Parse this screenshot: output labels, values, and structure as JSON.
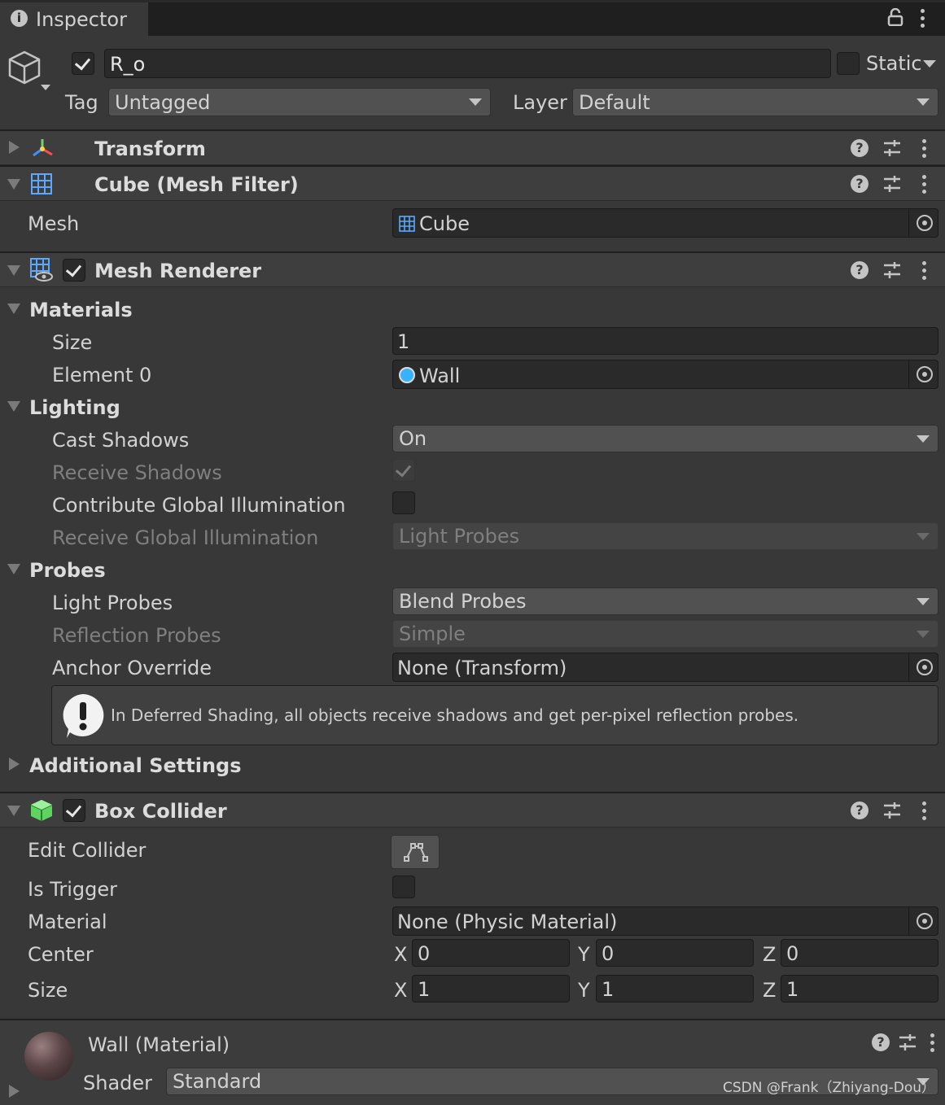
{
  "tab": {
    "title": "Inspector"
  },
  "header": {
    "name": "R_o",
    "active": true,
    "static_label": "Static",
    "tag_label": "Tag",
    "tag_value": "Untagged",
    "layer_label": "Layer",
    "layer_value": "Default"
  },
  "transform": {
    "title": "Transform"
  },
  "mesh_filter": {
    "title": "Cube (Mesh Filter)",
    "mesh_label": "Mesh",
    "mesh_value": "Cube"
  },
  "mesh_renderer": {
    "title": "Mesh Renderer",
    "materials": {
      "title": "Materials",
      "size_label": "Size",
      "size_value": "1",
      "element0_label": "Element 0",
      "element0_value": "Wall"
    },
    "lighting": {
      "title": "Lighting",
      "cast_shadows_label": "Cast Shadows",
      "cast_shadows_value": "On",
      "receive_shadows_label": "Receive Shadows",
      "contribute_gi_label": "Contribute Global Illumination",
      "receive_gi_label": "Receive Global Illumination",
      "receive_gi_value": "Light Probes"
    },
    "probes": {
      "title": "Probes",
      "light_probes_label": "Light Probes",
      "light_probes_value": "Blend Probes",
      "reflection_probes_label": "Reflection Probes",
      "reflection_probes_value": "Simple",
      "anchor_override_label": "Anchor Override",
      "anchor_override_value": "None (Transform)"
    },
    "help_message": "In Deferred Shading, all objects receive shadows and get per-pixel reflection probes.",
    "additional_settings": "Additional Settings"
  },
  "box_collider": {
    "title": "Box Collider",
    "edit_collider_label": "Edit Collider",
    "is_trigger_label": "Is Trigger",
    "material_label": "Material",
    "material_value": "None (Physic Material)",
    "center_label": "Center",
    "center": {
      "x": "0",
      "y": "0",
      "z": "0"
    },
    "size_label": "Size",
    "size": {
      "x": "1",
      "y": "1",
      "z": "1"
    },
    "axis_x": "X",
    "axis_y": "Y",
    "axis_z": "Z"
  },
  "material": {
    "title": "Wall (Material)",
    "shader_label": "Shader",
    "shader_value": "Standard"
  },
  "watermark": "CSDN @Frank（Zhiyang-Dou）",
  "colors": {
    "background": "#383838",
    "header_background": "#3e3e3e",
    "field_background": "#2a2a2a",
    "text": "#d2d2d2",
    "disabled_text": "#7f7f7f"
  }
}
